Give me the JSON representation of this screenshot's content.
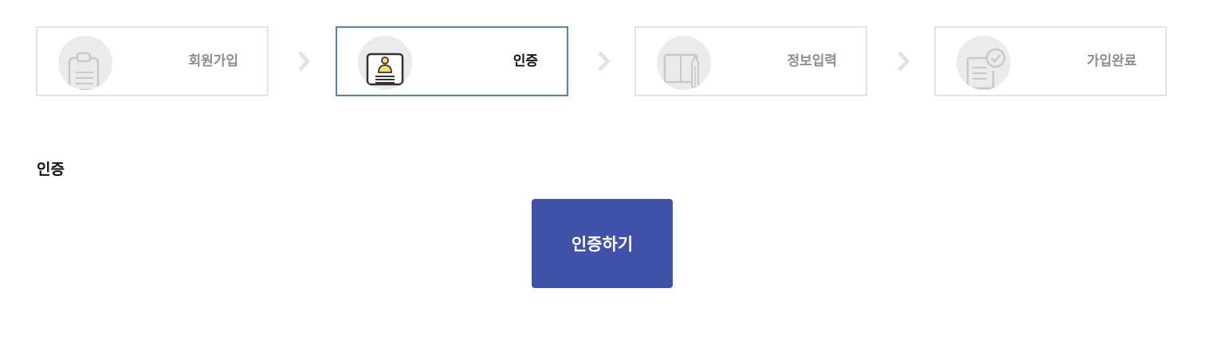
{
  "stepper": {
    "steps": [
      {
        "label": "회원가입",
        "icon": "clipboard-icon",
        "state": "inactive"
      },
      {
        "label": "인증",
        "icon": "id-card-icon",
        "state": "active"
      },
      {
        "label": "정보입력",
        "icon": "notebook-pencil-icon",
        "state": "inactive"
      },
      {
        "label": "가입완료",
        "icon": "document-check-icon",
        "state": "inactive"
      }
    ],
    "separator_icon": "chevron-right-icon"
  },
  "section": {
    "title": "인증"
  },
  "actions": {
    "verify_label": "인증하기"
  },
  "colors": {
    "active_border": "#5b7fb8",
    "inactive_border": "#e3e3e3",
    "button_bg": "#3f51a8",
    "icon_bg": "#ebebeb",
    "accent_yellow": "#f5dc6e"
  }
}
